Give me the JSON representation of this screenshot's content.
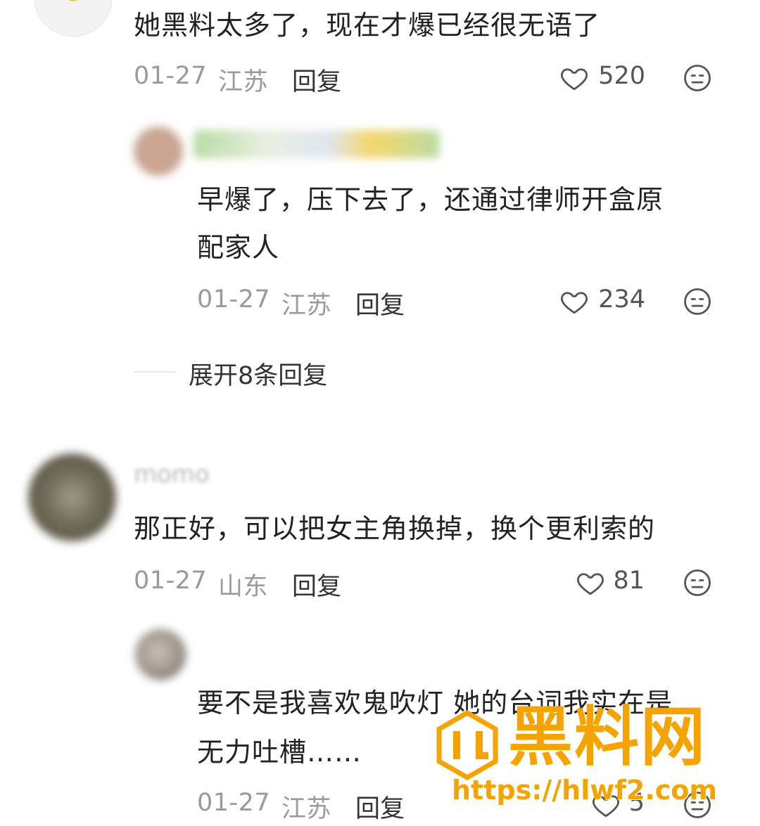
{
  "comments": [
    {
      "text": "她黑料太多了，现在才爆已经很无语了",
      "date": "01-27",
      "region": "江苏",
      "reply_label": "回复",
      "likes": "520",
      "replies": [
        {
          "text_line1": "早爆了，压下去了，还通过律师开盒原",
          "text_line2": "配家人",
          "date": "01-27",
          "region": "江苏",
          "reply_label": "回复",
          "likes": "234"
        }
      ],
      "expand_label": "展开8条回复"
    },
    {
      "username": "momo",
      "text": "那正好，可以把女主角换掉，换个更利索的",
      "date": "01-27",
      "region": "山东",
      "reply_label": "回复",
      "likes": "81",
      "replies": [
        {
          "text_line1": "要不是我喜欢鬼吹灯 她的台词我实在是",
          "text_line2": "无力吐槽……",
          "date": "01-27",
          "region": "江苏",
          "reply_label": "回复",
          "likes": "5"
        }
      ]
    }
  ],
  "watermark": {
    "brand": "黑料网",
    "url": "https://hlwf2.com",
    "color": "#f5a300"
  }
}
